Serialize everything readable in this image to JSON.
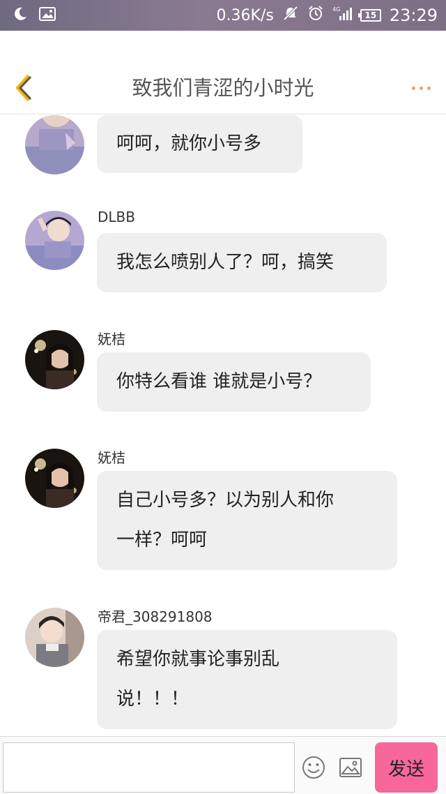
{
  "status_bar": {
    "speed": "0.36K/s",
    "battery": "15",
    "time": "23:29",
    "icons": [
      "moon-icon",
      "image-icon",
      "mute-icon",
      "alarm-icon",
      "signal-4g-icon",
      "battery-icon"
    ]
  },
  "header": {
    "title": "致我们青涩的小时光",
    "back_icon": "chevron-left-icon",
    "more_icon": "more-dots-icon",
    "accent_color": "#f2a05c"
  },
  "messages": [
    {
      "sender": "",
      "lines": [
        "呵呵，就你小号多"
      ]
    },
    {
      "sender": "DLBB",
      "lines": [
        "我怎么喷别人了？呵，搞笑"
      ]
    },
    {
      "sender": "妩桔",
      "lines": [
        "你特么看谁 谁就是小号？"
      ]
    },
    {
      "sender": "妩桔",
      "lines": [
        "自己小号多？以为别人和你",
        "一样？呵呵"
      ]
    },
    {
      "sender": "帝君_308291808",
      "lines": [
        "希望你就事论事别乱",
        "说！！！"
      ]
    }
  ],
  "input_bar": {
    "placeholder": "",
    "send_label": "发送",
    "send_color": "#f7679a"
  }
}
